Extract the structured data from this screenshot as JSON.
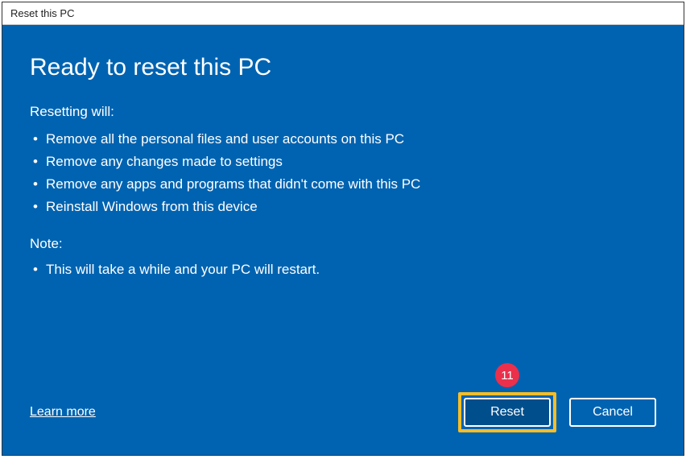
{
  "window": {
    "title": "Reset this PC"
  },
  "heading": "Ready to reset this PC",
  "section1": {
    "label": "Resetting will:",
    "items": [
      "Remove all the personal files and user accounts on this PC",
      "Remove any changes made to settings",
      "Remove any apps and programs that didn't come with this PC",
      "Reinstall Windows from this device"
    ]
  },
  "section2": {
    "label": "Note:",
    "items": [
      "This will take a while and your PC will restart."
    ]
  },
  "footer": {
    "learn_more": "Learn more",
    "reset_label": "Reset",
    "cancel_label": "Cancel"
  },
  "annotation": {
    "badge": "11"
  }
}
